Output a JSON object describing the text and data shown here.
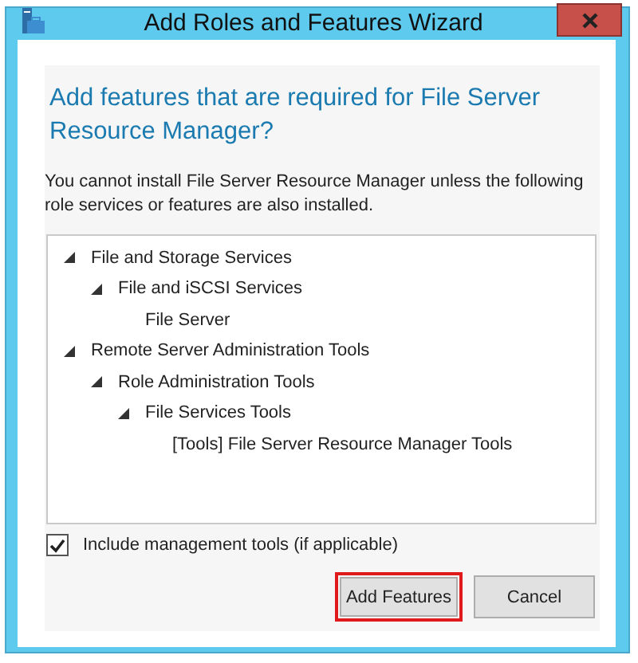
{
  "window": {
    "title": "Add Roles and Features Wizard"
  },
  "heading": "Add features that are required for File Server Resource Manager?",
  "message": "You cannot install File Server Resource Manager unless the following role services or features are also installed.",
  "tree": [
    {
      "label": "File and Storage Services",
      "expanded": true,
      "children": [
        {
          "label": "File and iSCSI Services",
          "expanded": true,
          "children": [
            {
              "label": "File Server"
            }
          ]
        }
      ]
    },
    {
      "label": "Remote Server Administration Tools",
      "expanded": true,
      "children": [
        {
          "label": "Role Administration Tools",
          "expanded": true,
          "children": [
            {
              "label": "File Services Tools",
              "expanded": true,
              "children": [
                {
                  "label": "[Tools] File Server Resource Manager Tools"
                }
              ]
            }
          ]
        }
      ]
    }
  ],
  "include_tools": {
    "label": "Include management tools (if applicable)",
    "checked": true
  },
  "buttons": [
    {
      "label": "Add Features",
      "highlighted": true
    },
    {
      "label": "Cancel",
      "highlighted": false
    }
  ]
}
